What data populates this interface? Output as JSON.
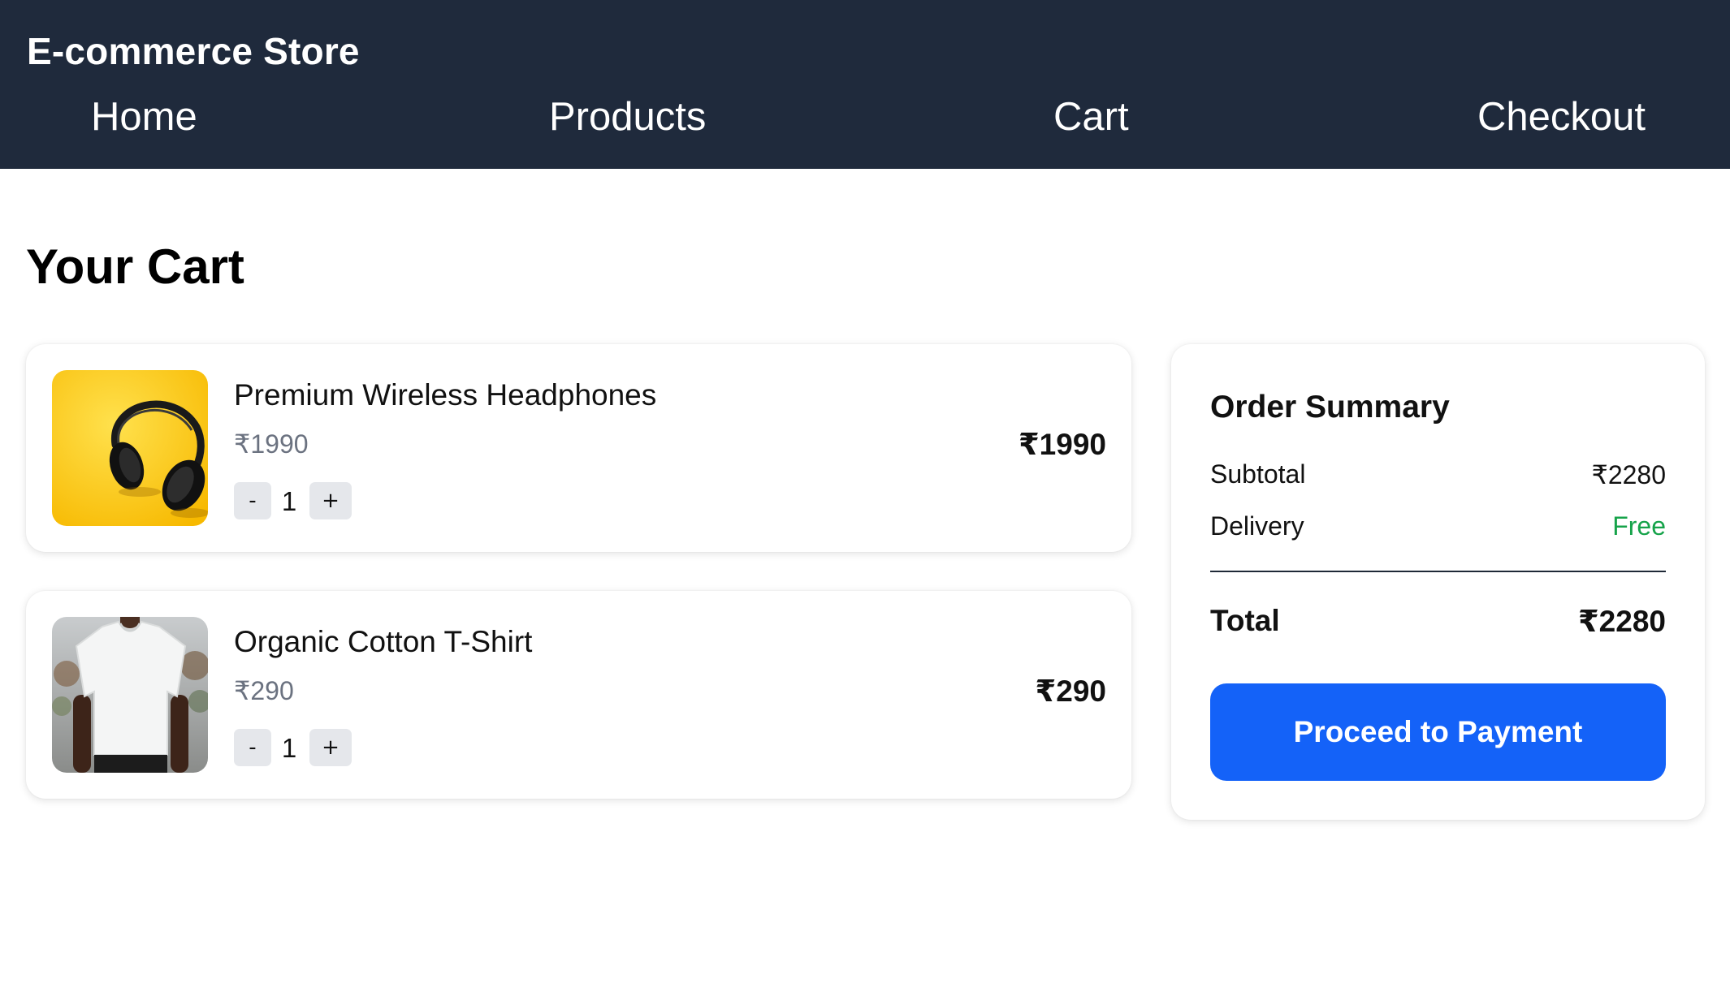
{
  "header": {
    "brand": "E-commerce Store",
    "nav": [
      {
        "label": "Home"
      },
      {
        "label": "Products"
      },
      {
        "label": "Cart"
      },
      {
        "label": "Checkout"
      }
    ],
    "background_color": "#1f2a3c"
  },
  "page": {
    "title": "Your Cart"
  },
  "cart": {
    "items": [
      {
        "name": "Premium Wireless Headphones",
        "unit_price": "₹1990",
        "quantity": "1",
        "line_total": "₹1990",
        "image_icon": "headphones-image",
        "decrement_label": "-",
        "increment_label": "+"
      },
      {
        "name": "Organic Cotton T-Shirt",
        "unit_price": "₹290",
        "quantity": "1",
        "line_total": "₹290",
        "image_icon": "tshirt-image",
        "decrement_label": "-",
        "increment_label": "+"
      }
    ]
  },
  "summary": {
    "title": "Order Summary",
    "subtotal_label": "Subtotal",
    "subtotal_value": "₹2280",
    "delivery_label": "Delivery",
    "delivery_value": "Free",
    "total_label": "Total",
    "total_value": "₹2280",
    "button_label": "Proceed to Payment",
    "button_color": "#1462f8",
    "free_color": "#16a34a"
  }
}
